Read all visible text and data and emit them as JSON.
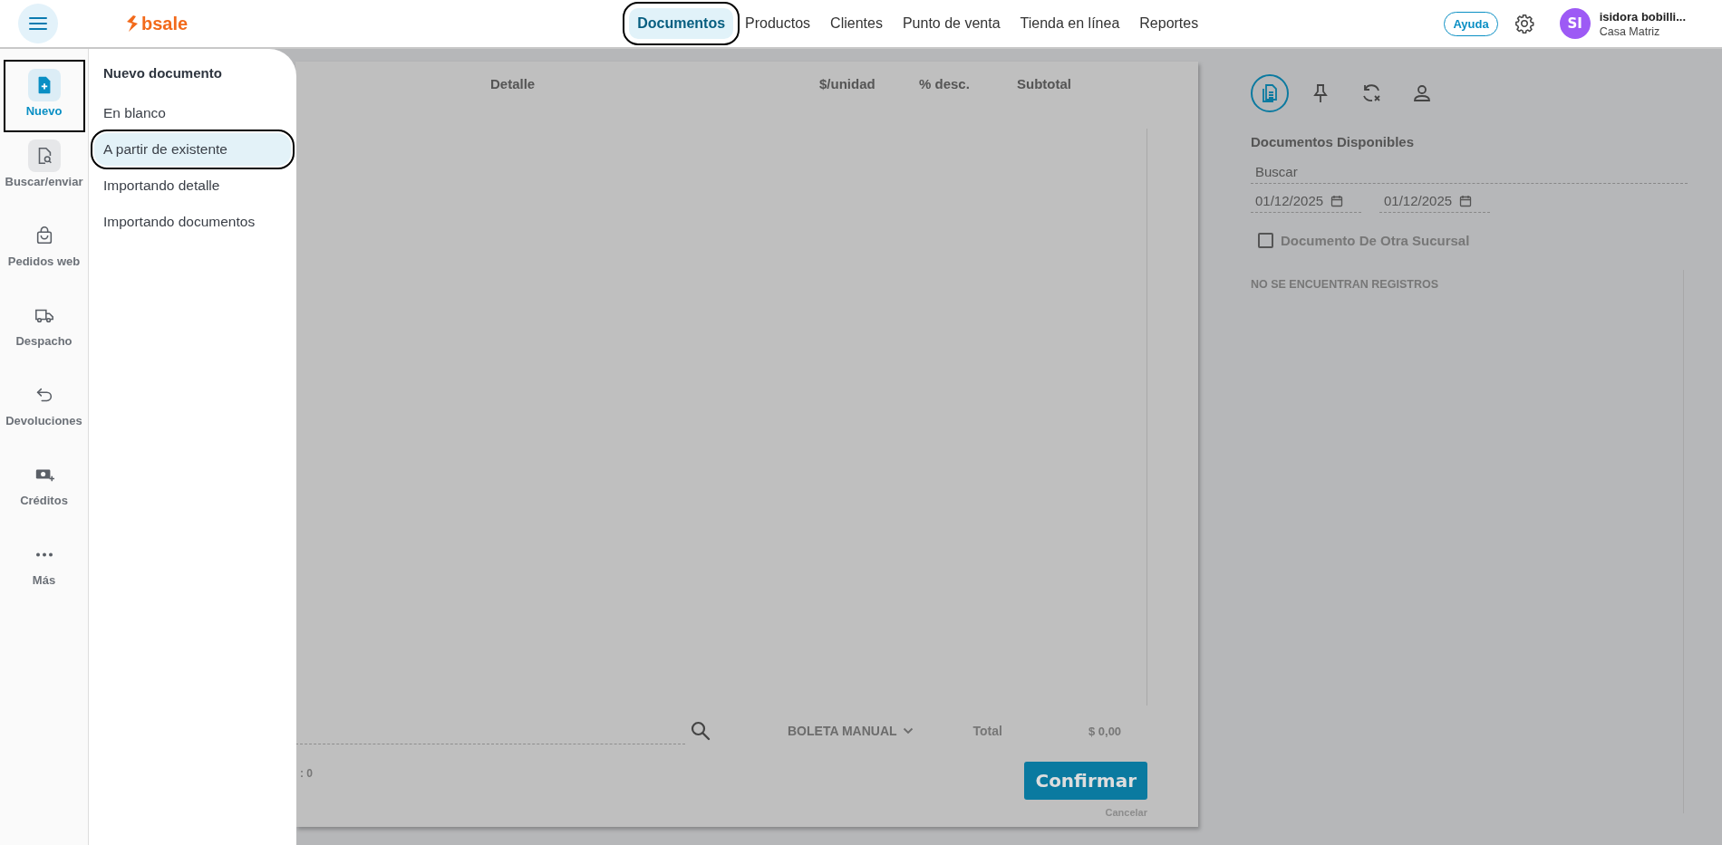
{
  "header": {
    "logo": "bsale",
    "nav": [
      {
        "label": "Documentos",
        "selected": true,
        "annotated": true
      },
      {
        "label": "Productos",
        "selected": false,
        "annotated": false
      },
      {
        "label": "Clientes",
        "selected": false,
        "annotated": false
      },
      {
        "label": "Punto de venta",
        "selected": false,
        "annotated": false
      },
      {
        "label": "Tienda en línea",
        "selected": false,
        "annotated": false
      },
      {
        "label": "Reportes",
        "selected": false,
        "annotated": false
      }
    ],
    "help": "Ayuda",
    "user": {
      "initials": "SI",
      "name": "isidora bobilli...",
      "branch": "Casa Matriz"
    }
  },
  "sidebar": {
    "items": [
      {
        "label": "Nuevo",
        "kind": "new",
        "selected": true,
        "annotated": true
      },
      {
        "label": "Buscar/enviar",
        "kind": "search",
        "selected": false,
        "annotated": false
      },
      {
        "label": "Pedidos web",
        "kind": "orders",
        "selected": false,
        "annotated": false
      },
      {
        "label": "Despacho",
        "kind": "shipping",
        "selected": false,
        "annotated": false
      },
      {
        "label": "Devoluciones",
        "kind": "returns",
        "selected": false,
        "annotated": false
      },
      {
        "label": "Créditos",
        "kind": "credits",
        "selected": false,
        "annotated": false
      },
      {
        "label": "Más",
        "kind": "more",
        "selected": false,
        "annotated": false
      }
    ]
  },
  "menu": {
    "title": "Nuevo documento",
    "items": [
      {
        "label": "En blanco",
        "selected": false,
        "annotated": false
      },
      {
        "label": "A partir de existente",
        "selected": true,
        "annotated": true
      },
      {
        "label": "Importando detalle",
        "selected": false,
        "annotated": false
      },
      {
        "label": "Importando documentos",
        "selected": false,
        "annotated": false
      }
    ]
  },
  "document": {
    "columns": [
      "Detalle",
      "$/unidad",
      "% desc.",
      "Subtotal"
    ],
    "doc_type": "BOLETA MANUAL",
    "total_label": "Total",
    "total": "$ 0,00",
    "count": ": 0",
    "confirm": "Confirmar",
    "cancel": "Cancelar"
  },
  "panel": {
    "tabs": [
      {
        "kind": "documents",
        "selected": true
      },
      {
        "kind": "pinned",
        "selected": false
      },
      {
        "kind": "sync",
        "selected": false
      },
      {
        "kind": "client",
        "selected": false
      }
    ],
    "title": "Documentos Disponibles",
    "search": {
      "placeholder": "Buscar"
    },
    "date_from": "01/12/2025",
    "date_to": "01/12/2025",
    "other_branch": {
      "label": "Documento De Otra Sucursal",
      "checked": false
    },
    "empty": "NO SE ENCUENTRAN REGISTROS"
  }
}
